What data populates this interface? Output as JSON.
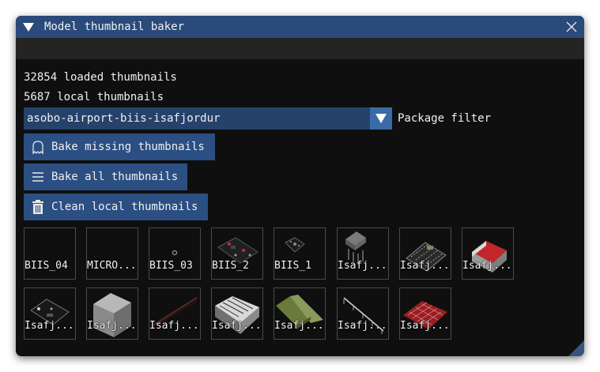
{
  "window": {
    "title": "Model thumbnail baker"
  },
  "stats": {
    "loaded": "32854 loaded thumbnails",
    "local": "5687 local thumbnails"
  },
  "package_filter": {
    "selected": "asobo-airport-biis-isafjordur",
    "label": "Package filter"
  },
  "buttons": {
    "bake_missing": "Bake missing thumbnails",
    "bake_all": "Bake all thumbnails",
    "clean_local": "Clean local thumbnails"
  },
  "thumbnails": [
    {
      "label": "BIIS_04"
    },
    {
      "label": "MICRO..."
    },
    {
      "label": "BIIS_03"
    },
    {
      "label": "BIIS_2"
    },
    {
      "label": "BIIS_1"
    },
    {
      "label": "Isafj..."
    },
    {
      "label": "Isafj..."
    },
    {
      "label": "Isafj..."
    },
    {
      "label": "Isafj..."
    },
    {
      "label": "Isafj..."
    },
    {
      "label": "Isafj..."
    },
    {
      "label": "Isafj..."
    },
    {
      "label": "Isafj..."
    },
    {
      "label": "Isafj..."
    },
    {
      "label": "Isafj..."
    }
  ],
  "colors": {
    "title_bar": "#294a7a",
    "button": "#2b4f82",
    "combo": "#25426b",
    "window_bg": "#0f0f0f"
  }
}
